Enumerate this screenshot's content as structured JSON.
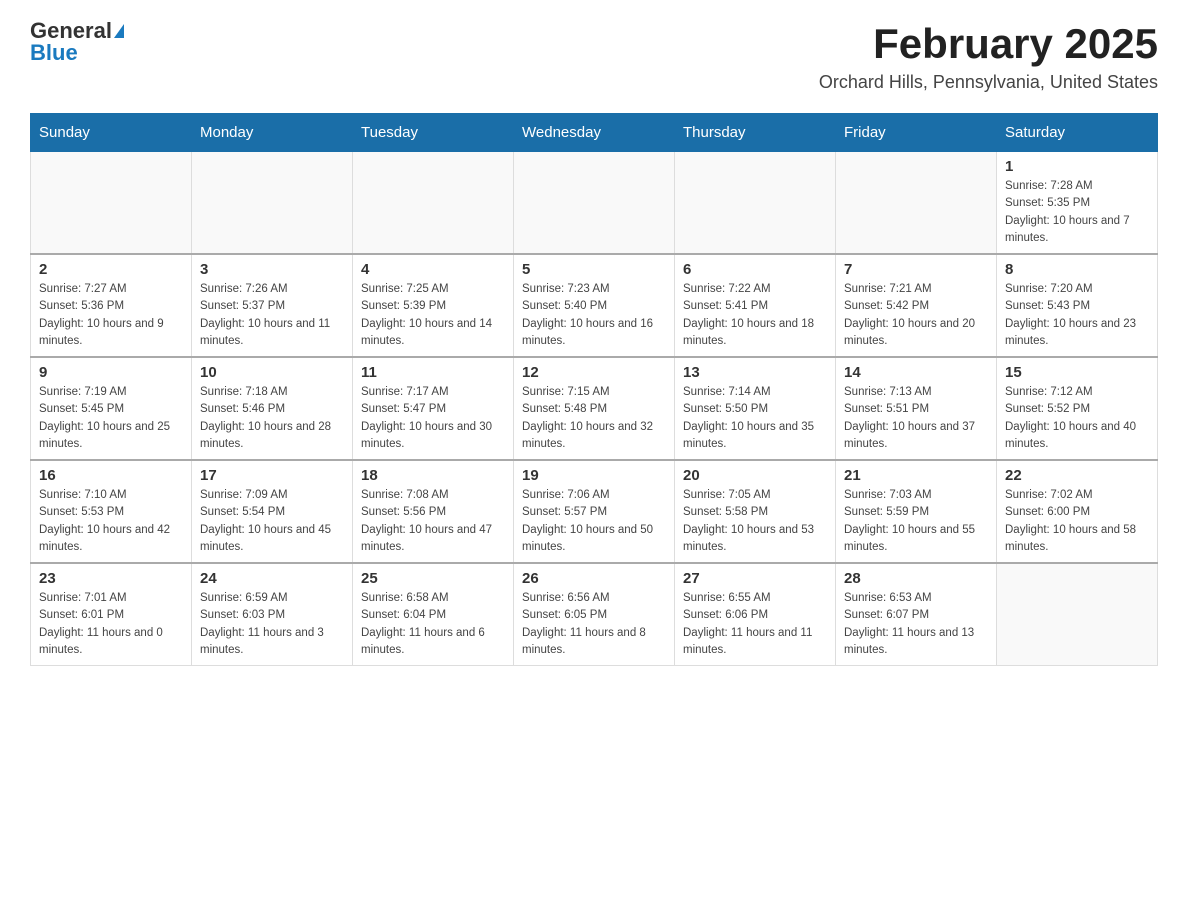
{
  "header": {
    "logo_general": "General",
    "logo_blue": "Blue",
    "month_title": "February 2025",
    "location": "Orchard Hills, Pennsylvania, United States"
  },
  "days_of_week": [
    "Sunday",
    "Monday",
    "Tuesday",
    "Wednesday",
    "Thursday",
    "Friday",
    "Saturday"
  ],
  "weeks": [
    [
      {
        "day": "",
        "sunrise": "",
        "sunset": "",
        "daylight": ""
      },
      {
        "day": "",
        "sunrise": "",
        "sunset": "",
        "daylight": ""
      },
      {
        "day": "",
        "sunrise": "",
        "sunset": "",
        "daylight": ""
      },
      {
        "day": "",
        "sunrise": "",
        "sunset": "",
        "daylight": ""
      },
      {
        "day": "",
        "sunrise": "",
        "sunset": "",
        "daylight": ""
      },
      {
        "day": "",
        "sunrise": "",
        "sunset": "",
        "daylight": ""
      },
      {
        "day": "1",
        "sunrise": "Sunrise: 7:28 AM",
        "sunset": "Sunset: 5:35 PM",
        "daylight": "Daylight: 10 hours and 7 minutes."
      }
    ],
    [
      {
        "day": "2",
        "sunrise": "Sunrise: 7:27 AM",
        "sunset": "Sunset: 5:36 PM",
        "daylight": "Daylight: 10 hours and 9 minutes."
      },
      {
        "day": "3",
        "sunrise": "Sunrise: 7:26 AM",
        "sunset": "Sunset: 5:37 PM",
        "daylight": "Daylight: 10 hours and 11 minutes."
      },
      {
        "day": "4",
        "sunrise": "Sunrise: 7:25 AM",
        "sunset": "Sunset: 5:39 PM",
        "daylight": "Daylight: 10 hours and 14 minutes."
      },
      {
        "day": "5",
        "sunrise": "Sunrise: 7:23 AM",
        "sunset": "Sunset: 5:40 PM",
        "daylight": "Daylight: 10 hours and 16 minutes."
      },
      {
        "day": "6",
        "sunrise": "Sunrise: 7:22 AM",
        "sunset": "Sunset: 5:41 PM",
        "daylight": "Daylight: 10 hours and 18 minutes."
      },
      {
        "day": "7",
        "sunrise": "Sunrise: 7:21 AM",
        "sunset": "Sunset: 5:42 PM",
        "daylight": "Daylight: 10 hours and 20 minutes."
      },
      {
        "day": "8",
        "sunrise": "Sunrise: 7:20 AM",
        "sunset": "Sunset: 5:43 PM",
        "daylight": "Daylight: 10 hours and 23 minutes."
      }
    ],
    [
      {
        "day": "9",
        "sunrise": "Sunrise: 7:19 AM",
        "sunset": "Sunset: 5:45 PM",
        "daylight": "Daylight: 10 hours and 25 minutes."
      },
      {
        "day": "10",
        "sunrise": "Sunrise: 7:18 AM",
        "sunset": "Sunset: 5:46 PM",
        "daylight": "Daylight: 10 hours and 28 minutes."
      },
      {
        "day": "11",
        "sunrise": "Sunrise: 7:17 AM",
        "sunset": "Sunset: 5:47 PM",
        "daylight": "Daylight: 10 hours and 30 minutes."
      },
      {
        "day": "12",
        "sunrise": "Sunrise: 7:15 AM",
        "sunset": "Sunset: 5:48 PM",
        "daylight": "Daylight: 10 hours and 32 minutes."
      },
      {
        "day": "13",
        "sunrise": "Sunrise: 7:14 AM",
        "sunset": "Sunset: 5:50 PM",
        "daylight": "Daylight: 10 hours and 35 minutes."
      },
      {
        "day": "14",
        "sunrise": "Sunrise: 7:13 AM",
        "sunset": "Sunset: 5:51 PM",
        "daylight": "Daylight: 10 hours and 37 minutes."
      },
      {
        "day": "15",
        "sunrise": "Sunrise: 7:12 AM",
        "sunset": "Sunset: 5:52 PM",
        "daylight": "Daylight: 10 hours and 40 minutes."
      }
    ],
    [
      {
        "day": "16",
        "sunrise": "Sunrise: 7:10 AM",
        "sunset": "Sunset: 5:53 PM",
        "daylight": "Daylight: 10 hours and 42 minutes."
      },
      {
        "day": "17",
        "sunrise": "Sunrise: 7:09 AM",
        "sunset": "Sunset: 5:54 PM",
        "daylight": "Daylight: 10 hours and 45 minutes."
      },
      {
        "day": "18",
        "sunrise": "Sunrise: 7:08 AM",
        "sunset": "Sunset: 5:56 PM",
        "daylight": "Daylight: 10 hours and 47 minutes."
      },
      {
        "day": "19",
        "sunrise": "Sunrise: 7:06 AM",
        "sunset": "Sunset: 5:57 PM",
        "daylight": "Daylight: 10 hours and 50 minutes."
      },
      {
        "day": "20",
        "sunrise": "Sunrise: 7:05 AM",
        "sunset": "Sunset: 5:58 PM",
        "daylight": "Daylight: 10 hours and 53 minutes."
      },
      {
        "day": "21",
        "sunrise": "Sunrise: 7:03 AM",
        "sunset": "Sunset: 5:59 PM",
        "daylight": "Daylight: 10 hours and 55 minutes."
      },
      {
        "day": "22",
        "sunrise": "Sunrise: 7:02 AM",
        "sunset": "Sunset: 6:00 PM",
        "daylight": "Daylight: 10 hours and 58 minutes."
      }
    ],
    [
      {
        "day": "23",
        "sunrise": "Sunrise: 7:01 AM",
        "sunset": "Sunset: 6:01 PM",
        "daylight": "Daylight: 11 hours and 0 minutes."
      },
      {
        "day": "24",
        "sunrise": "Sunrise: 6:59 AM",
        "sunset": "Sunset: 6:03 PM",
        "daylight": "Daylight: 11 hours and 3 minutes."
      },
      {
        "day": "25",
        "sunrise": "Sunrise: 6:58 AM",
        "sunset": "Sunset: 6:04 PM",
        "daylight": "Daylight: 11 hours and 6 minutes."
      },
      {
        "day": "26",
        "sunrise": "Sunrise: 6:56 AM",
        "sunset": "Sunset: 6:05 PM",
        "daylight": "Daylight: 11 hours and 8 minutes."
      },
      {
        "day": "27",
        "sunrise": "Sunrise: 6:55 AM",
        "sunset": "Sunset: 6:06 PM",
        "daylight": "Daylight: 11 hours and 11 minutes."
      },
      {
        "day": "28",
        "sunrise": "Sunrise: 6:53 AM",
        "sunset": "Sunset: 6:07 PM",
        "daylight": "Daylight: 11 hours and 13 minutes."
      },
      {
        "day": "",
        "sunrise": "",
        "sunset": "",
        "daylight": ""
      }
    ]
  ]
}
